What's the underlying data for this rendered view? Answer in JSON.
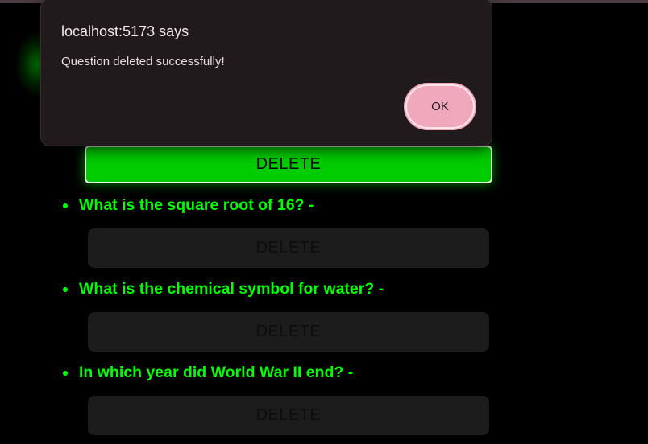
{
  "dialog": {
    "title": "localhost:5173 says",
    "message": "Question deleted successfully!",
    "ok_label": "OK"
  },
  "active_delete_label": "DELETE",
  "questions": [
    {
      "text": "What is the square root of 16? -",
      "delete_label": "DELETE"
    },
    {
      "text": "What is the chemical symbol for water? -",
      "delete_label": "DELETE"
    },
    {
      "text": "In which year did World War II end? -",
      "delete_label": "DELETE"
    }
  ],
  "colors": {
    "background": "#000000",
    "accent_green": "#00ff00",
    "active_button_green": "#00cc00",
    "disabled_button": "#1c1c1c",
    "dialog_bg": "#211a1c",
    "ok_button": "#f0a8bd"
  }
}
